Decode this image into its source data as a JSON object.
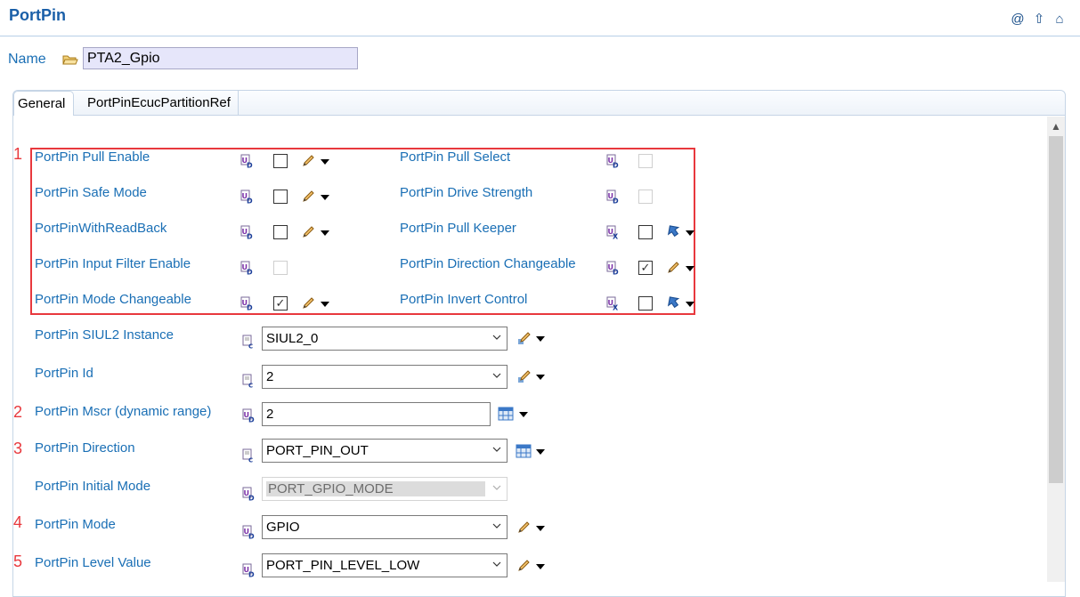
{
  "header": {
    "title": "PortPin",
    "icons": [
      "at-icon",
      "up-arrow-icon",
      "home-icon"
    ]
  },
  "name": {
    "label": "Name",
    "value": "PTA2_Gpio"
  },
  "tabs": [
    {
      "label": "General"
    },
    {
      "label": "PortPinEcucPartitionRef"
    }
  ],
  "markers": [
    "1",
    "2",
    "3",
    "4",
    "5"
  ],
  "checkbox_params": {
    "left": [
      {
        "label": "PortPin Pull Enable",
        "checked": false,
        "enabled": true
      },
      {
        "label": "PortPin Safe Mode",
        "checked": false,
        "enabled": true
      },
      {
        "label": "PortPinWithReadBack",
        "checked": false,
        "enabled": true
      },
      {
        "label": "PortPin Input Filter Enable",
        "checked": false,
        "enabled": false
      },
      {
        "label": "PortPin Mode Changeable",
        "checked": true,
        "enabled": true
      }
    ],
    "right": [
      {
        "label": "PortPin Pull Select",
        "checked": false,
        "enabled": false
      },
      {
        "label": "PortPin Drive Strength",
        "checked": false,
        "enabled": false
      },
      {
        "label": "PortPin Pull Keeper",
        "checked": false,
        "enabled": true
      },
      {
        "label": "PortPin Direction Changeable",
        "checked": true,
        "enabled": true
      },
      {
        "label": "PortPin Invert Control",
        "checked": false,
        "enabled": true
      }
    ]
  },
  "fields": {
    "siul2_instance": {
      "label": "PortPin SIUL2 Instance",
      "value": "SIUL2_0"
    },
    "id": {
      "label": "PortPin Id",
      "value": "2"
    },
    "mscr": {
      "label": "PortPin Mscr (dynamic range)",
      "value": "2"
    },
    "direction": {
      "label": "PortPin Direction",
      "value": "PORT_PIN_OUT"
    },
    "initial_mode": {
      "label": "PortPin Initial Mode",
      "value": "PORT_GPIO_MODE"
    },
    "mode": {
      "label": "PortPin Mode",
      "value": "GPIO"
    },
    "level_value": {
      "label": "PortPin Level Value",
      "value": "PORT_PIN_LEVEL_LOW"
    }
  },
  "colors": {
    "title": "#1a5fa8",
    "label": "#1a6fb5",
    "highlight": "#e8383d",
    "name_field_bg": "#e6e6fa"
  }
}
